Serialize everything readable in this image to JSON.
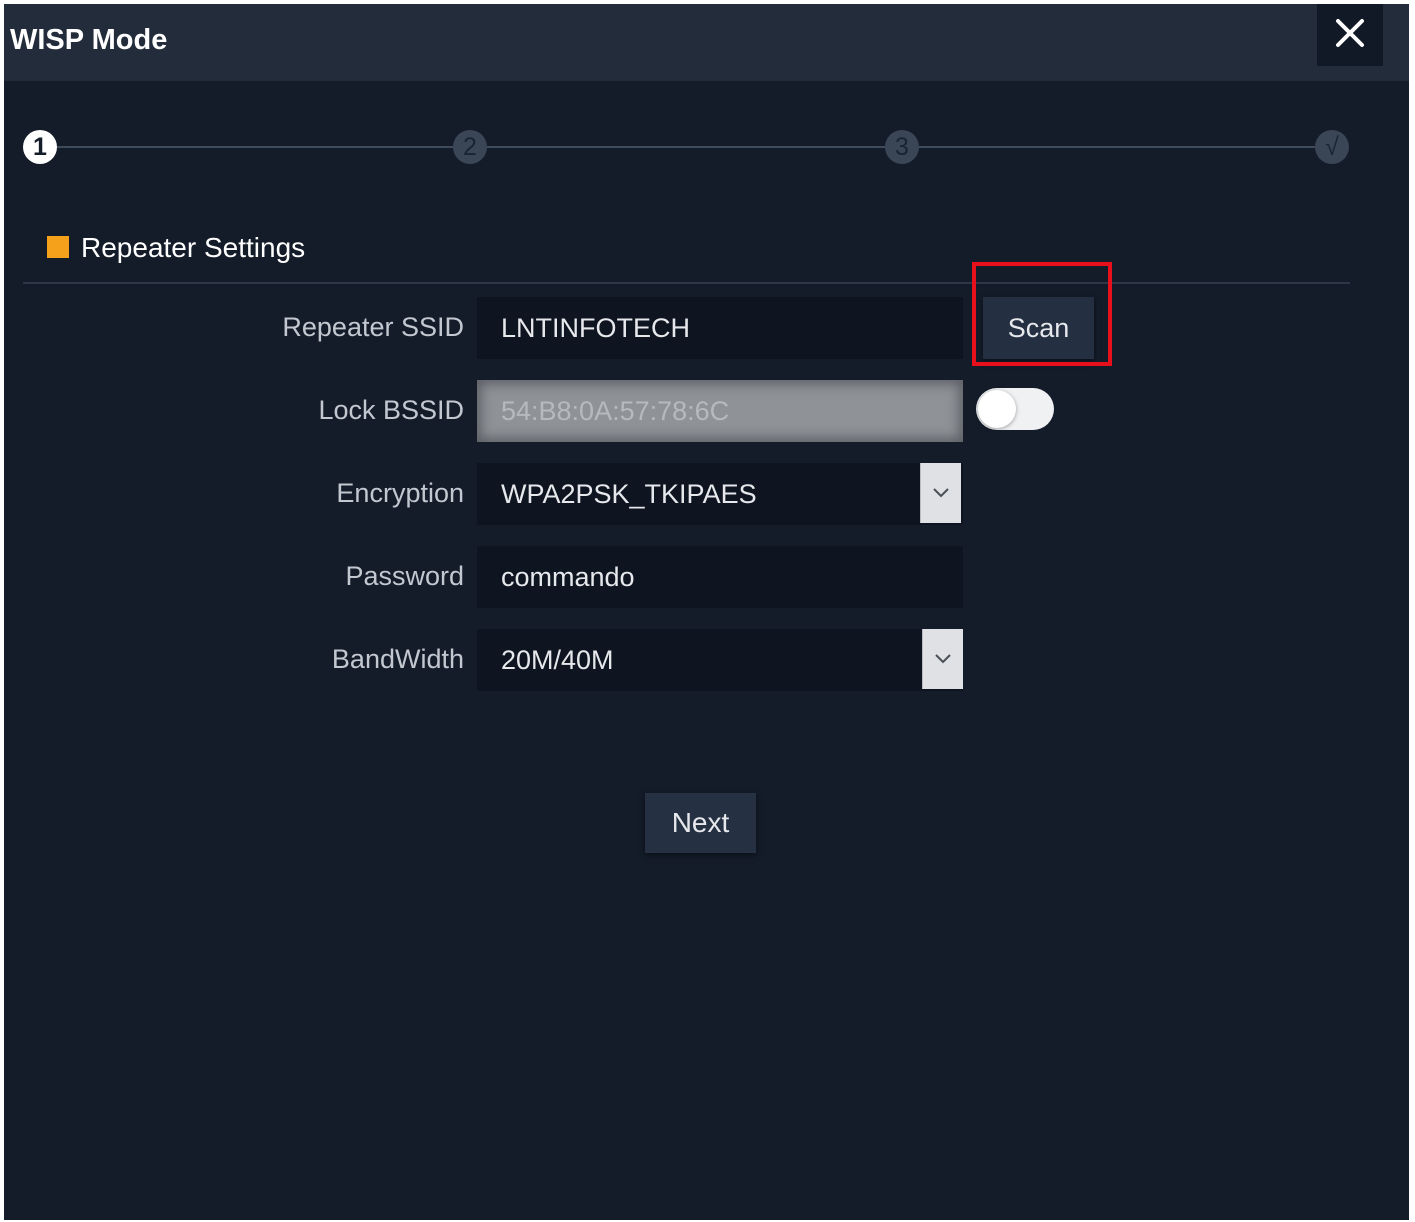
{
  "dialog": {
    "title": "WISP Mode",
    "close_icon": "close-icon"
  },
  "stepper": {
    "steps": [
      {
        "label": "1",
        "state": "active"
      },
      {
        "label": "2",
        "state": "inactive"
      },
      {
        "label": "3",
        "state": "inactive"
      },
      {
        "label": "√",
        "state": "inactive"
      }
    ]
  },
  "section": {
    "title": "Repeater Settings",
    "marker_color": "#f5a11c"
  },
  "form": {
    "repeater_ssid": {
      "label": "Repeater SSID",
      "value": "LNTINFOTECH"
    },
    "scan_label": "Scan",
    "lock_bssid": {
      "label": "Lock BSSID",
      "value": "54:B8:0A:57:78:6C",
      "toggle_on": false
    },
    "encryption": {
      "label": "Encryption",
      "value": "WPA2PSK_TKIPAES"
    },
    "password": {
      "label": "Password",
      "value": "commando"
    },
    "bandwidth": {
      "label": "BandWidth",
      "value": "20M/40M"
    }
  },
  "next_label": "Next",
  "colors": {
    "background": "#141c2a",
    "titlebar": "#222c3a",
    "highlight": "#e8101c"
  }
}
